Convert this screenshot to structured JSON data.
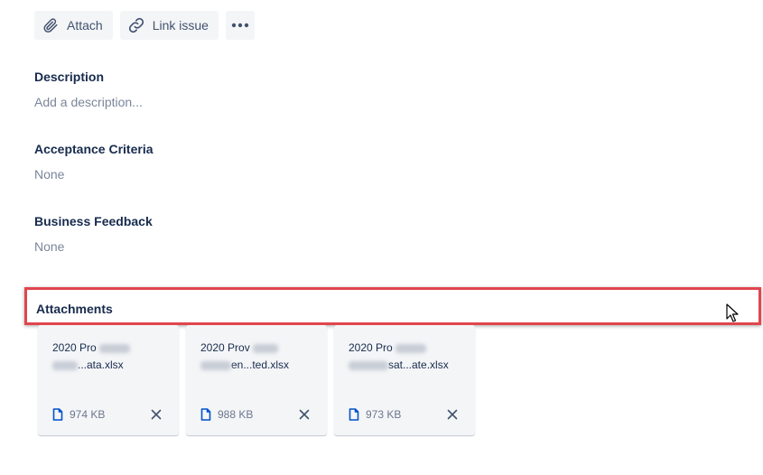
{
  "toolbar": {
    "attach_label": "Attach",
    "link_issue_label": "Link issue",
    "more_icon": "more-horizontal-icon"
  },
  "fields": {
    "description": {
      "label": "Description",
      "placeholder": "Add a description..."
    },
    "acceptance_criteria": {
      "label": "Acceptance Criteria",
      "value": "None"
    },
    "business_feedback": {
      "label": "Business Feedback",
      "value": "None"
    }
  },
  "attachments": {
    "label": "Attachments",
    "highlight_color": "#e0464d",
    "items": [
      {
        "name_line1": "2020 Pro",
        "name_line2": "...ata.xlsx",
        "size": "974 KB"
      },
      {
        "name_line1": "2020 Prov",
        "name_line2": "en...ted.xlsx",
        "size": "988 KB"
      },
      {
        "name_line1": "2020 Pro",
        "name_line2": "sat...ate.xlsx",
        "size": "973 KB"
      }
    ]
  },
  "colors": {
    "text_primary": "#172b4d",
    "text_muted": "#7a869a",
    "button_bg": "#f4f5f7",
    "file_icon": "#0052cc"
  }
}
